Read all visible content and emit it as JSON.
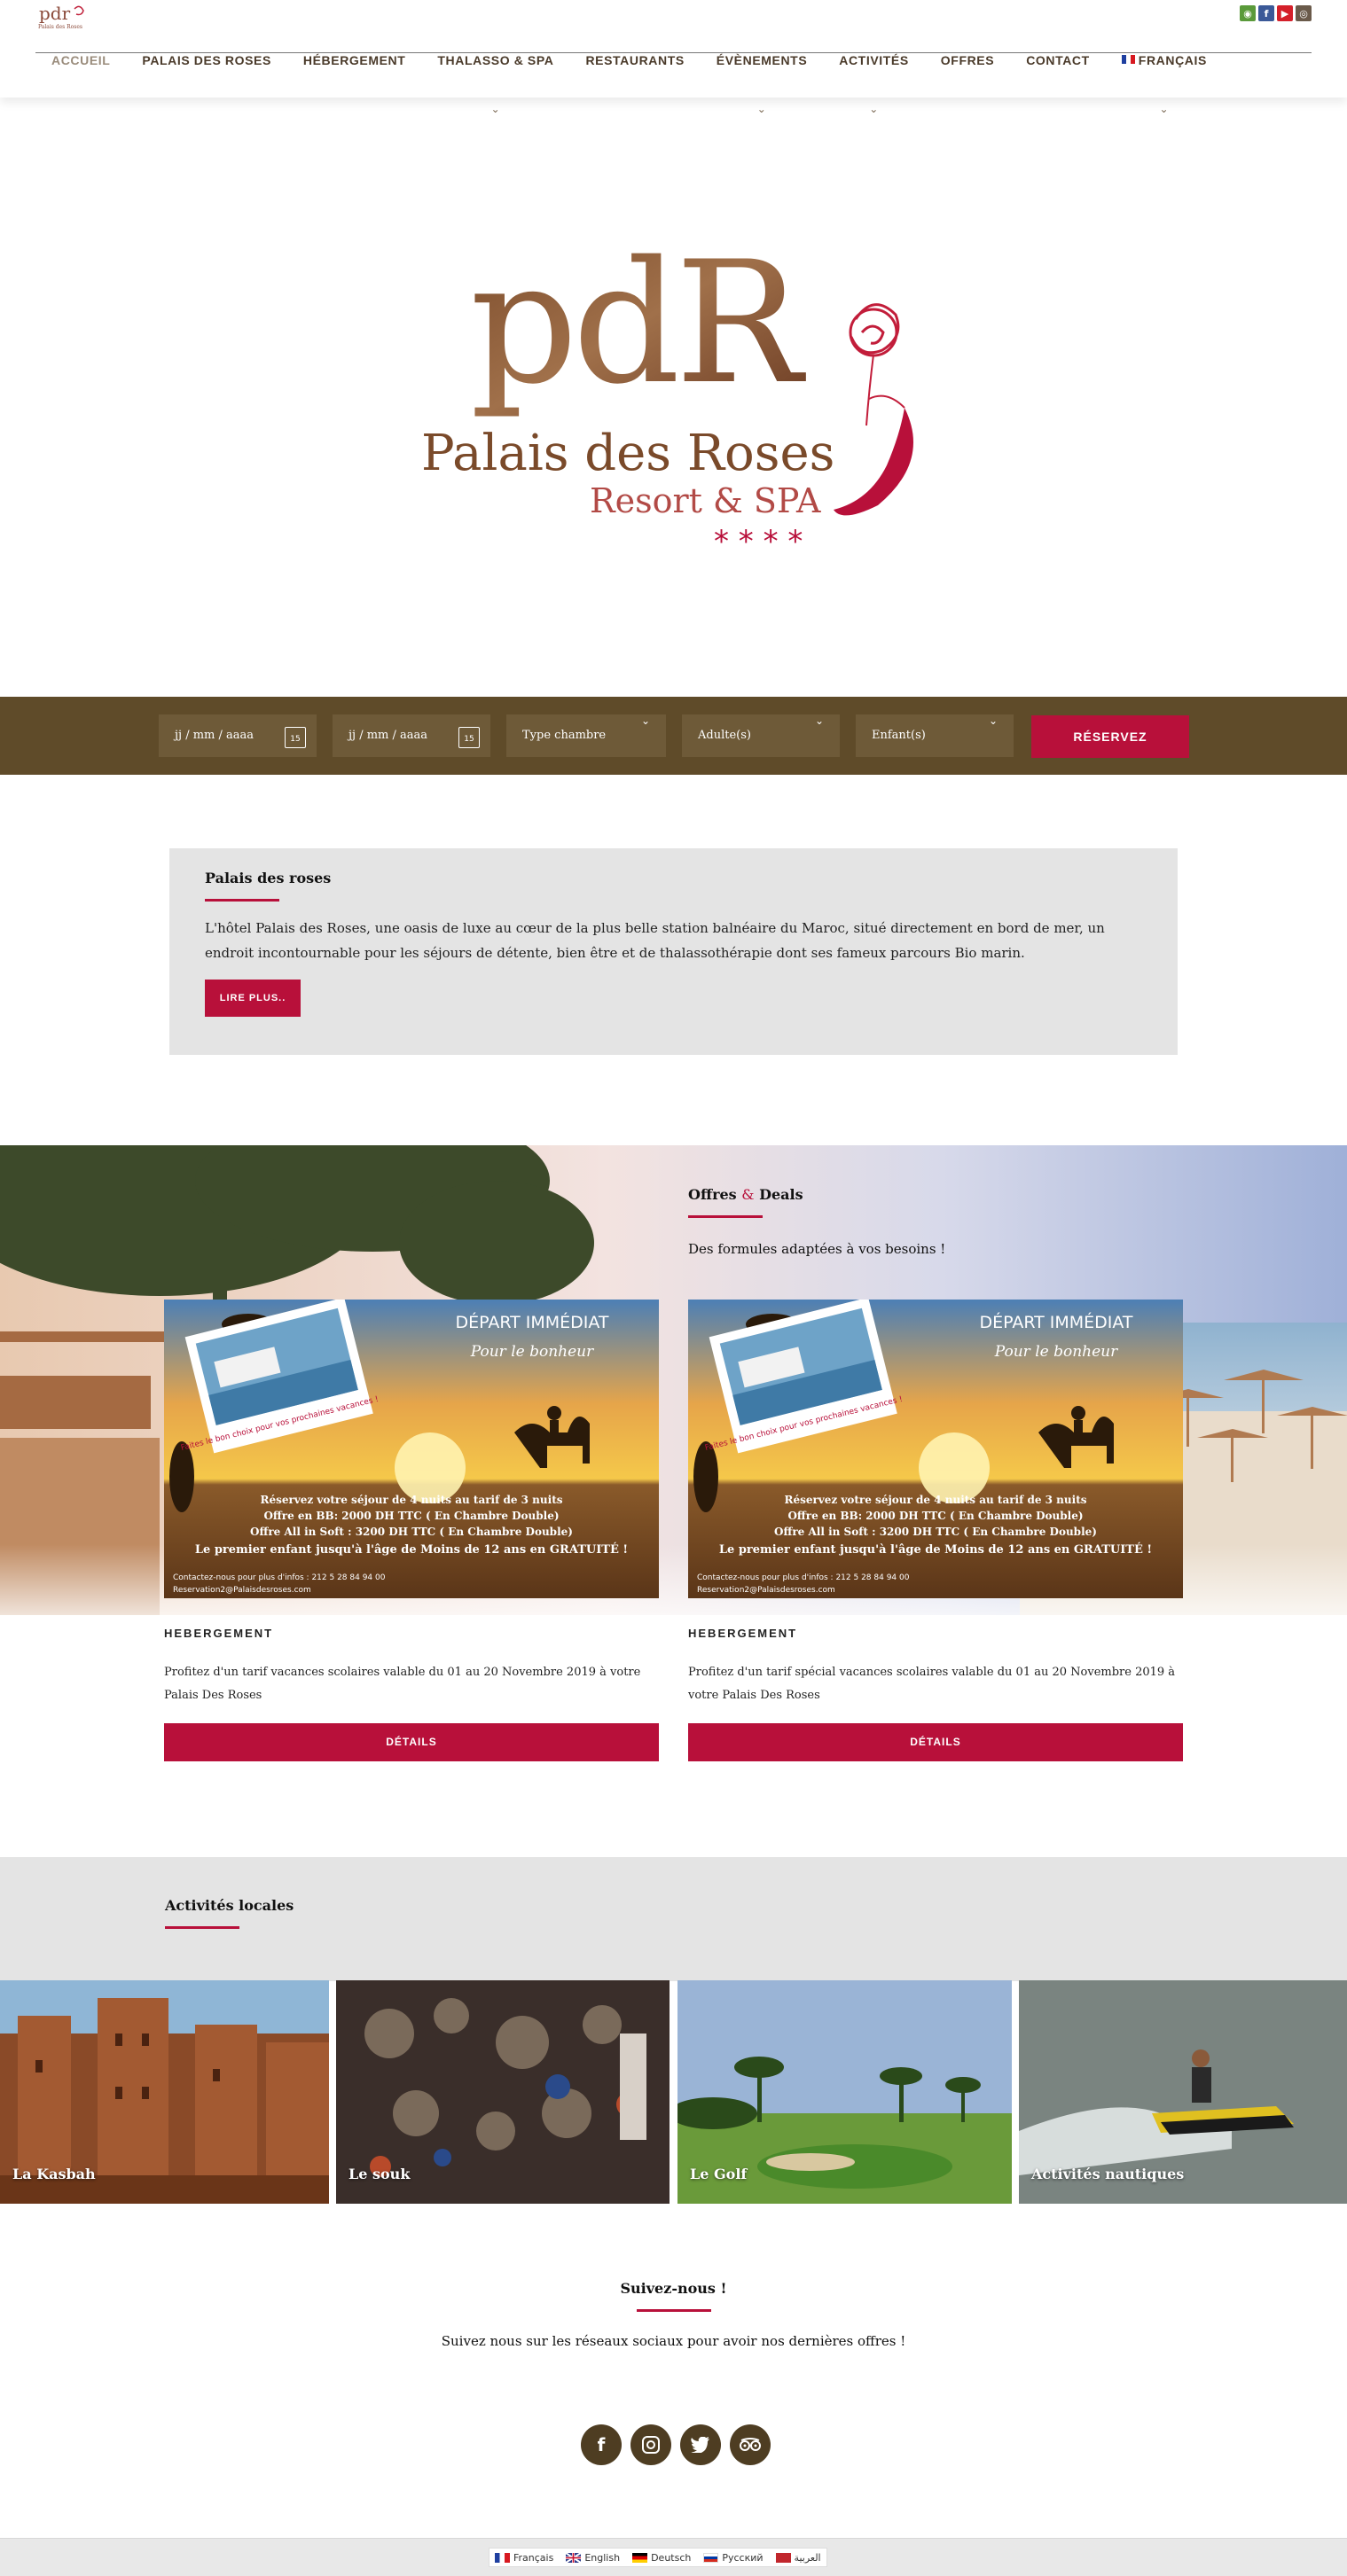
{
  "header": {
    "logo_text": "pdr",
    "logo_subtext": "Palais des Roses",
    "social_icons": [
      "tripadvisor-icon",
      "facebook-icon",
      "youtube-icon",
      "instagram-icon"
    ],
    "nav": [
      {
        "label": "ACCUEIL",
        "active": true,
        "has_submenu": false
      },
      {
        "label": "PALAIS DES ROSES",
        "active": false,
        "has_submenu": false
      },
      {
        "label": "HÉBERGEMENT",
        "active": false,
        "has_submenu": false
      },
      {
        "label": "THALASSO & SPA",
        "active": false,
        "has_submenu": true
      },
      {
        "label": "RESTAURANTS",
        "active": false,
        "has_submenu": false
      },
      {
        "label": "ÉVÈNEMENTS",
        "active": false,
        "has_submenu": true
      },
      {
        "label": "ACTIVITÉS",
        "active": false,
        "has_submenu": true
      },
      {
        "label": "OFFRES",
        "active": false,
        "has_submenu": false
      },
      {
        "label": "CONTACT",
        "active": false,
        "has_submenu": false
      },
      {
        "label": "FRANÇAIS",
        "active": false,
        "has_submenu": true
      }
    ]
  },
  "hero": {
    "logo_monogram": "pdR",
    "logo_name": "Palais des Roses",
    "logo_tagline": "Resort & SPA",
    "logo_stars": "* * * *"
  },
  "booking": {
    "arrival_placeholder": "jj / mm / aaaa",
    "departure_placeholder": "jj / mm / aaaa",
    "calendar_day": "15",
    "room_type": "Type chambre",
    "adults": "Adulte(s)",
    "children": "Enfant(s)",
    "submit_label": "RÉSERVEZ"
  },
  "intro": {
    "title": "Palais des roses",
    "text": "L'hôtel Palais des Roses, une oasis de luxe au cœur de la plus belle station balnéaire du Maroc, situé directement en bord de mer, un endroit incontournable pour les séjours de détente, bien être et de thalassothérapie dont ses fameux parcours Bio marin.",
    "button_label": "LIRE PLUS.."
  },
  "offers": {
    "title_part1": "Offres",
    "title_amp": "&",
    "title_part2": "Deals",
    "subtitle": "Des formules adaptées à vos besoins !",
    "cards": [
      {
        "image": {
          "headline": "DÉPART IMMÉDIAT",
          "subline": "Pour le bonheur",
          "postcard_caption": "Faites le bon choix pour vos prochaines vacances !",
          "lines": [
            "Réservez votre séjour de 4 nuits au tarif de 3 nuits",
            "Offre en BB: 2000 DH TTC ( En Chambre Double)",
            "Offre All in Soft : 3200 DH TTC ( En Chambre Double)",
            "Le premier enfant  jusqu'à l'âge de Moins de 12 ans en GRATUITÉ !"
          ],
          "contact_line": "Contactez-nous pour plus d'infos : 212 5 28 84 94 00",
          "email_line": "Reservation2@Palaisdesroses.com"
        },
        "type": "HEBERGEMENT",
        "description": "Profitez d'un tarif vacances scolaires  valable du 01 au 20 Novembre  2019   à votre Palais Des Roses",
        "button_label": "DÉTAILS"
      },
      {
        "image": {
          "headline": "DÉPART IMMÉDIAT",
          "subline": "Pour le bonheur",
          "postcard_caption": "Faites le bon choix pour vos prochaines vacances !",
          "lines": [
            "Réservez votre séjour de 4 nuits au tarif de 3 nuits",
            "Offre en BB: 2000 DH TTC ( En Chambre Double)",
            "Offre All in Soft : 3200 DH TTC ( En Chambre Double)",
            "Le premier enfant  jusqu'à l'âge de Moins de 12 ans en GRATUITÉ !"
          ],
          "contact_line": "Contactez-nous pour plus d'infos : 212 5 28 84 94 00",
          "email_line": "Reservation2@Palaisdesroses.com"
        },
        "type": "HEBERGEMENT",
        "description": "Profitez d'un tarif spécial vacances scolaires valable  du 01 au 20 Novembre 2019 à votre Palais Des Roses",
        "button_label": "DÉTAILS"
      }
    ]
  },
  "activities": {
    "title": "Activités locales",
    "items": [
      {
        "label": "La Kasbah"
      },
      {
        "label": "Le souk"
      },
      {
        "label": "Le Golf"
      },
      {
        "label": "Activités nautiques"
      }
    ]
  },
  "follow": {
    "title": "Suivez-nous !",
    "text": "Suivez nous sur les réseaux sociaux pour avoir nos dernières offres !",
    "icons": [
      "facebook-icon",
      "instagram-icon",
      "twitter-icon",
      "tripadvisor-icon"
    ]
  },
  "languages": [
    {
      "label": "Français"
    },
    {
      "label": "English"
    },
    {
      "label": "Deutsch"
    },
    {
      "label": "Русский"
    },
    {
      "label": "العربية"
    }
  ],
  "colors": {
    "accent": "#b8103a",
    "brown": "#5f4b29",
    "grey_band": "#e4e4e4"
  }
}
